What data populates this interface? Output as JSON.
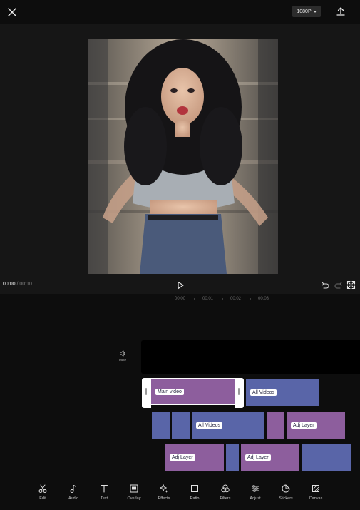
{
  "header": {
    "resolution_label": "1080P"
  },
  "playback": {
    "current_time": "00:00",
    "separator": "/",
    "total_time": "00:10"
  },
  "ruler": {
    "marks": [
      "00:00",
      "00:01",
      "00:02",
      "00:03"
    ]
  },
  "timeline": {
    "mute_label": "Mute",
    "track1": [
      {
        "label": "Main video",
        "type": "adj",
        "selected": true
      },
      {
        "label": "All Videos",
        "type": "video"
      }
    ],
    "track2": [
      {
        "label": "",
        "type": "video"
      },
      {
        "label": "",
        "type": "video"
      },
      {
        "label": "All Videos",
        "type": "video"
      },
      {
        "label": "",
        "type": "adj"
      },
      {
        "label": "Adj Layer",
        "type": "adj"
      }
    ],
    "track3": [
      {
        "label": "Adj Layer",
        "type": "adj"
      },
      {
        "label": "",
        "type": "video"
      },
      {
        "label": "Adj Layer",
        "type": "adj"
      },
      {
        "label": "",
        "type": "video"
      }
    ]
  },
  "toolbar": {
    "items": [
      {
        "label": "Edit",
        "icon": "scissors-icon"
      },
      {
        "label": "Audio",
        "icon": "music-note-icon"
      },
      {
        "label": "Text",
        "icon": "text-icon"
      },
      {
        "label": "Overlay",
        "icon": "overlay-icon"
      },
      {
        "label": "Effects",
        "icon": "sparkle-icon"
      },
      {
        "label": "Ratio",
        "icon": "ratio-icon"
      },
      {
        "label": "Filters",
        "icon": "filters-icon"
      },
      {
        "label": "Adjust",
        "icon": "sliders-icon"
      },
      {
        "label": "Stickers",
        "icon": "sticker-icon"
      },
      {
        "label": "Canvas",
        "icon": "canvas-icon"
      }
    ]
  },
  "colors": {
    "video_clip": "#5965a8",
    "adj_clip": "#8d5e9d",
    "background": "#0d0d0d"
  }
}
